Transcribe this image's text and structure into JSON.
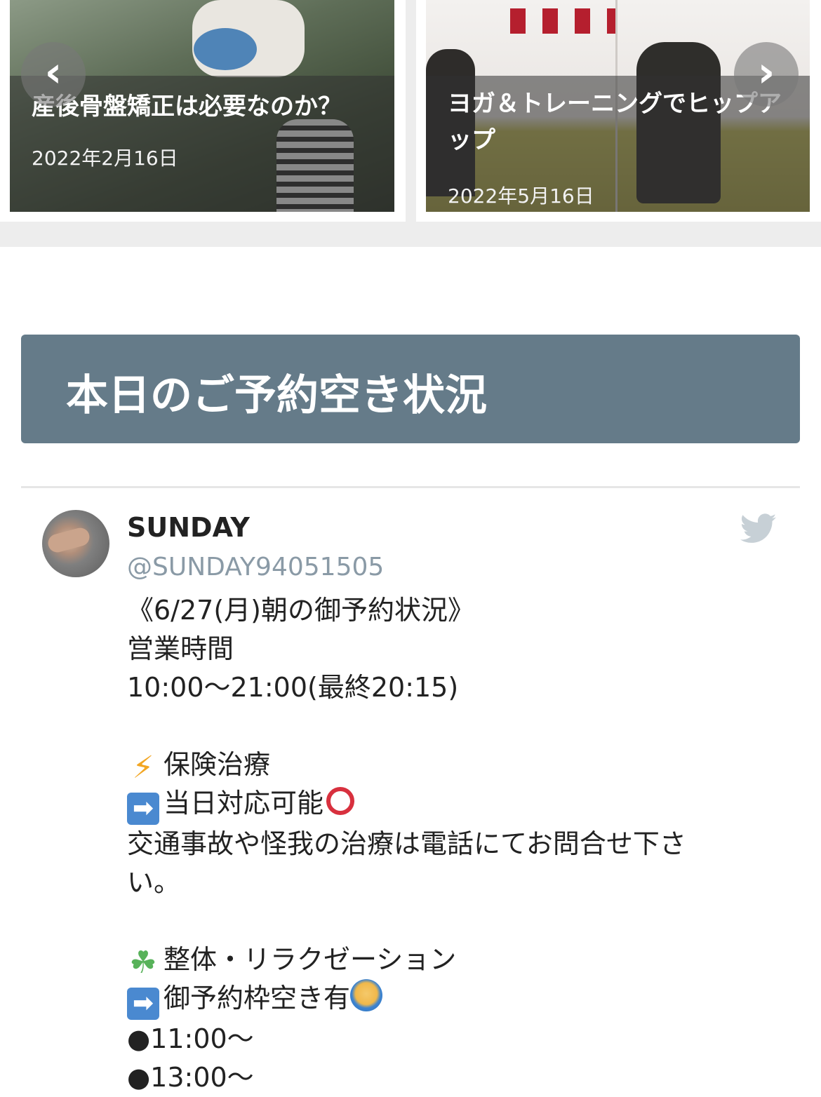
{
  "carousel": {
    "prev_glyph": "‹",
    "next_glyph": "›",
    "posts": [
      {
        "title": "産後骨盤矯正は必要なのか？",
        "date": "2022年2月16日"
      },
      {
        "title": "ヨガ＆トレーニングでヒップアップ",
        "date": "2022年5月16日"
      }
    ]
  },
  "section": {
    "heading": "本日のご予約空き状況"
  },
  "tweet": {
    "name": "SUNDAY",
    "handle": "@SUNDAY94051505",
    "lines": [
      "《6/27(月)朝の御予約状況》",
      "営業時間",
      "10:00〜21:00(最終20:15)",
      "",
      "保険治療",
      "当日対応可能",
      "交通事故や怪我の治療は電話にてお問合せ下さ",
      "い。",
      "",
      "整体・リラクゼーション",
      "御予約枠空き有",
      "●11:00〜",
      "●13:00〜"
    ]
  },
  "colors": {
    "heading_bg": "#657b89",
    "handle": "#8a9aa6",
    "twitter_bird": "#c7d0d6"
  },
  "icons": [
    "chevron-left-icon",
    "chevron-right-icon",
    "twitter-bird-icon",
    "high-voltage-emoji",
    "right-arrow-emoji",
    "red-circle-emoji",
    "four-leaf-clover-emoji",
    "person-gesturing-ok-emoji"
  ]
}
